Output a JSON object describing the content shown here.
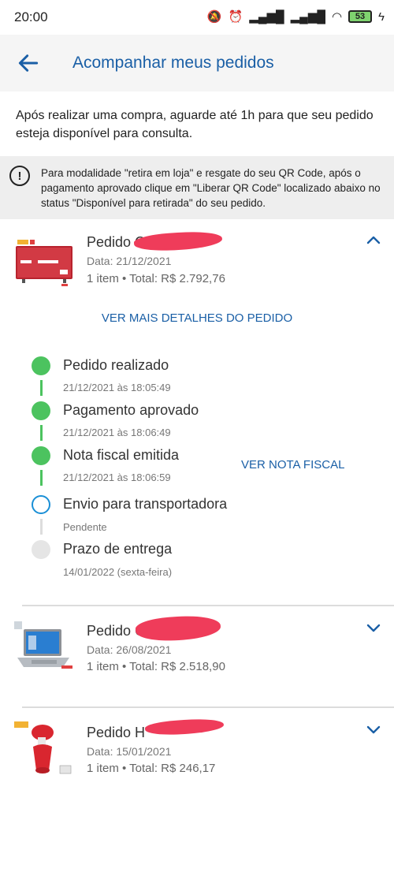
{
  "status_bar": {
    "time": "20:00",
    "battery": "53"
  },
  "header": {
    "title": "Acompanhar meus pedidos"
  },
  "intro": "Após realizar uma compra, aguarde até 1h para que seu pedido esteja disponível para consulta.",
  "notice": "Para modalidade \"retira em loja\" e resgate do seu QR Code, após o pagamento aprovado clique em \"Liberar QR Code\" localizado abaixo no status \"Disponível para retirada\" do seu pedido.",
  "orders": [
    {
      "name": "Pedido C",
      "date": "Data: 21/12/2021",
      "total": "1 item • Total: R$ 2.792,76",
      "product_icon": "tv-icon",
      "expanded": true
    },
    {
      "name": "Pedido C",
      "date": "Data: 26/08/2021",
      "total": "1 item • Total: R$ 2.518,90",
      "product_icon": "laptop-icon",
      "expanded": false
    },
    {
      "name": "Pedido H",
      "date": "Data: 15/01/2021",
      "total": "1 item • Total: R$ 246,17",
      "product_icon": "steamer-icon",
      "expanded": false
    }
  ],
  "details_link": "VER MAIS DETALHES DO PEDIDO",
  "timeline": [
    {
      "label": "Pedido realizado",
      "sub": "21/12/2021 às 18:05:49",
      "state": "done"
    },
    {
      "label": "Pagamento aprovado",
      "sub": "21/12/2021 às 18:06:49",
      "state": "done"
    },
    {
      "label": "Nota fiscal emitida",
      "sub": "21/12/2021 às 18:06:59",
      "state": "done"
    },
    {
      "label": "Envio para transportadora",
      "sub": "Pendente",
      "state": "current"
    },
    {
      "label": "Prazo de entrega",
      "sub": "14/01/2022 (sexta-feira)",
      "state": "pending"
    }
  ],
  "nota_fiscal_link": "VER NOTA FISCAL",
  "colors": {
    "accent": "#1a5fa6",
    "done": "#4cc35f",
    "current": "#1a8fd6",
    "redaction": "#ef3c5a"
  }
}
